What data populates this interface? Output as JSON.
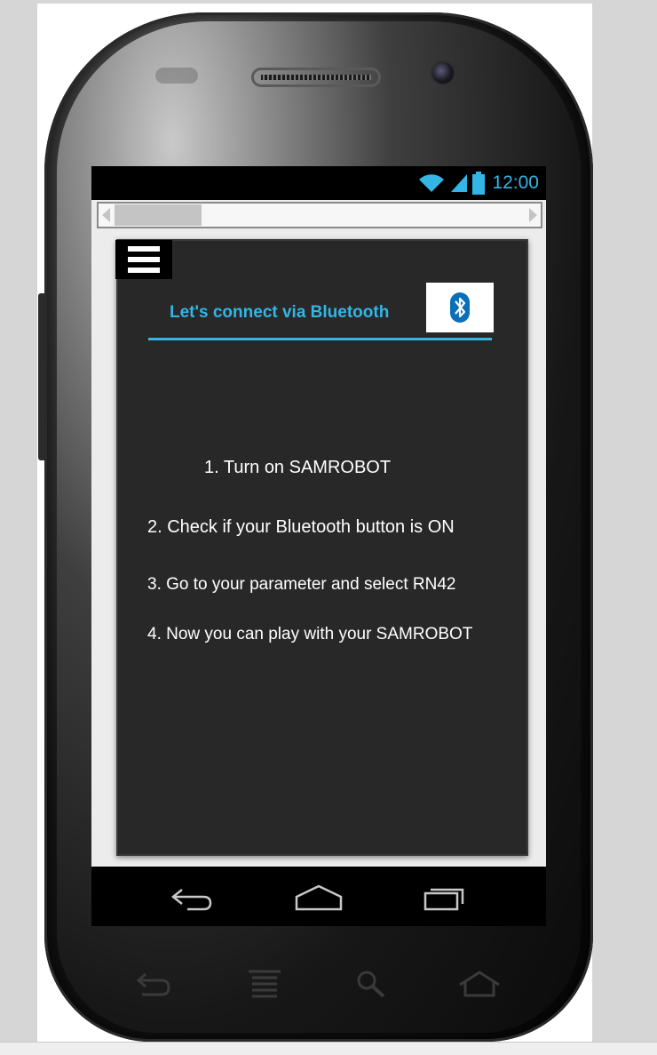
{
  "status_bar": {
    "time": "12:00",
    "icons": [
      "wifi-icon",
      "signal-icon",
      "battery-icon"
    ],
    "accent": "#33b5e5"
  },
  "header": {
    "title": "Let's connect via Bluetooth",
    "bluetooth_icon": "bluetooth-icon",
    "menu_icon": "hamburger-menu-icon"
  },
  "steps": [
    "1. Turn on SAMROBOT",
    "2. Check if your Bluetooth button is ON",
    "3. Go to your parameter and select RN42",
    "4. Now you can play with your SAMROBOT"
  ],
  "nav": {
    "icons": [
      "back-icon",
      "home-icon",
      "recent-apps-icon"
    ]
  },
  "hardware_keys": {
    "icons": [
      "back-icon",
      "menu-icon",
      "search-icon",
      "home-icon"
    ]
  },
  "colors": {
    "accent": "#33b5e5",
    "panel": "#282828"
  }
}
